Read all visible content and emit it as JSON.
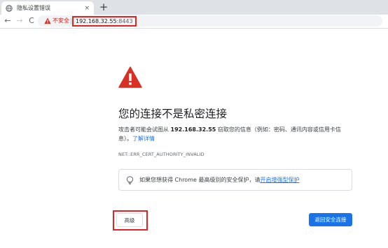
{
  "tab": {
    "title": "隐私设置错误",
    "close_label": "×",
    "new_tab_label": "+"
  },
  "toolbar": {
    "back_label": "←",
    "forward_label": "→",
    "reload_label": "C",
    "security_label": "不安全",
    "url_host": "192.168.32.55",
    "url_port": ":8443"
  },
  "interstitial": {
    "heading": "您的连接不是私密连接",
    "desc_prefix": "攻击者可能会试图从 ",
    "desc_host": "192.168.32.55",
    "desc_suffix": " 窃取您的信息（例如：密码、通讯内容或信用卡信息）。",
    "learn_more": "了解详情",
    "error_code": "NET::ERR_CERT_AUTHORITY_INVALID",
    "promo_text": "如果您想获得 Chrome 最高级别的安全保护，请",
    "promo_link": "开启增强型保护"
  },
  "buttons": {
    "advanced": "高级",
    "back_to_safety": "返回安全连接"
  },
  "colors": {
    "accent": "#1a73e8",
    "danger": "#d93025",
    "highlight": "#e52222"
  }
}
